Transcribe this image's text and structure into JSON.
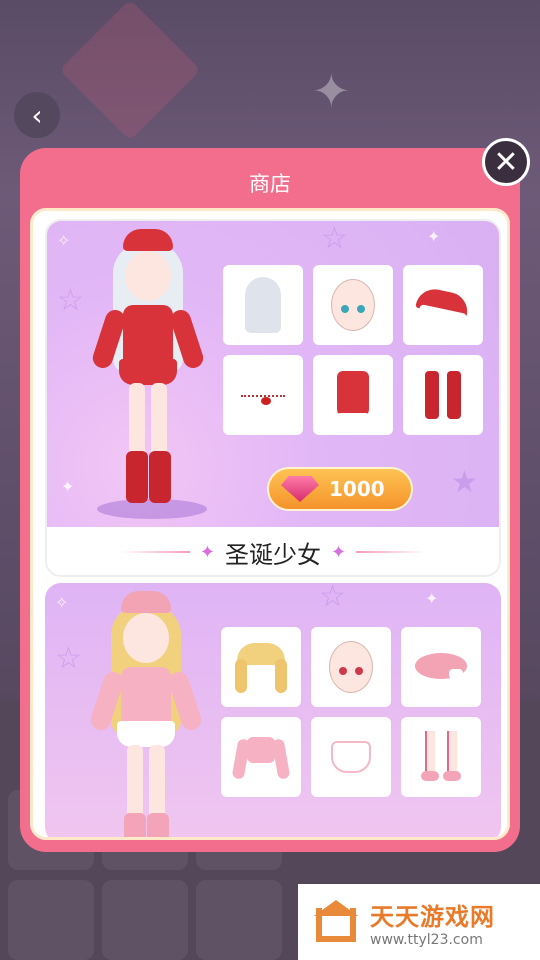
{
  "shop": {
    "title": "商店",
    "close_icon": "close-icon"
  },
  "back_icon": "chevron-left-icon",
  "outfits": [
    {
      "name": "圣诞少女",
      "price": "1000",
      "currency_icon": "gem-icon",
      "items": [
        "silver-hair-icon",
        "face-icon",
        "santa-hat-icon",
        "necklace-icon",
        "red-dress-icon",
        "red-boots-icon"
      ]
    },
    {
      "name": "",
      "items": [
        "blonde-braids-icon",
        "face-icon",
        "pink-beret-icon",
        "pink-top-icon",
        "white-skirt-icon",
        "pink-shoes-icon"
      ]
    }
  ],
  "ad": {
    "title": "天天游戏网",
    "url": "www.ttyl23.com"
  },
  "colors": {
    "modal": "#f26e8c",
    "price_button": "#f4932a",
    "accent": "#d86ee0"
  }
}
